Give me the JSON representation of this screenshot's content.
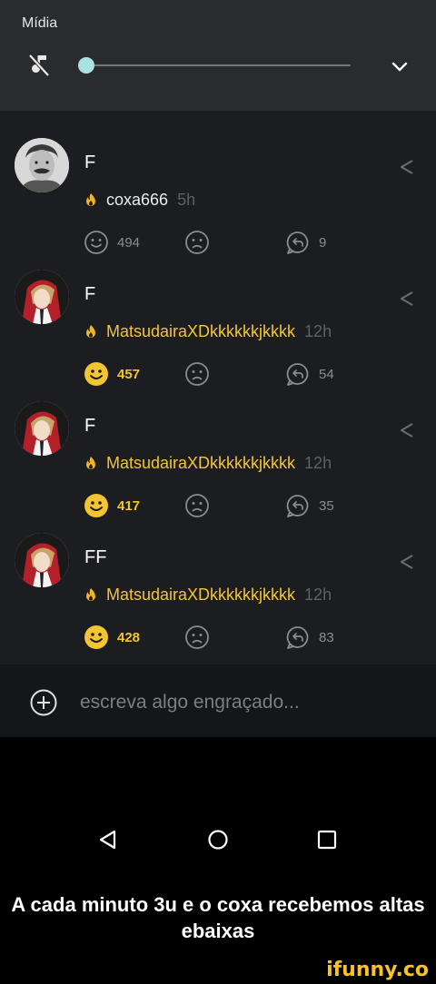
{
  "media": {
    "title": "Mídia",
    "mute_icon": "music-note-off-icon",
    "expand_icon": "chevron-down-icon",
    "volume_level": 0
  },
  "comments": [
    {
      "text": "F",
      "username": "coxa666",
      "time": "5h",
      "pro": false,
      "smiles": "494",
      "smiled": false,
      "replies": "9",
      "avatar": "portrait-bw"
    },
    {
      "text": "F",
      "username": "MatsudairaXDkkkkkkjkkkk",
      "time": "12h",
      "pro": true,
      "smiles": "457",
      "smiled": true,
      "replies": "54",
      "avatar": "anime-red"
    },
    {
      "text": "F",
      "username": "MatsudairaXDkkkkkkjkkkk",
      "time": "12h",
      "pro": true,
      "smiles": "417",
      "smiled": true,
      "replies": "35",
      "avatar": "anime-red"
    },
    {
      "text": "FF",
      "username": "MatsudairaXDkkkkkkjkkkk",
      "time": "12h",
      "pro": true,
      "smiles": "428",
      "smiled": true,
      "replies": "83",
      "avatar": "anime-red"
    }
  ],
  "composer": {
    "placeholder": "escreva algo engraçado..."
  },
  "caption": "A cada minuto 3u e o coxa recebemos altas ebaixas",
  "watermark": "ifunny.co",
  "colors": {
    "accent": "#f5c531",
    "feed_bg": "#1c1d21",
    "panel_bg": "#2a2b2d",
    "slider": "#a8e3df"
  }
}
